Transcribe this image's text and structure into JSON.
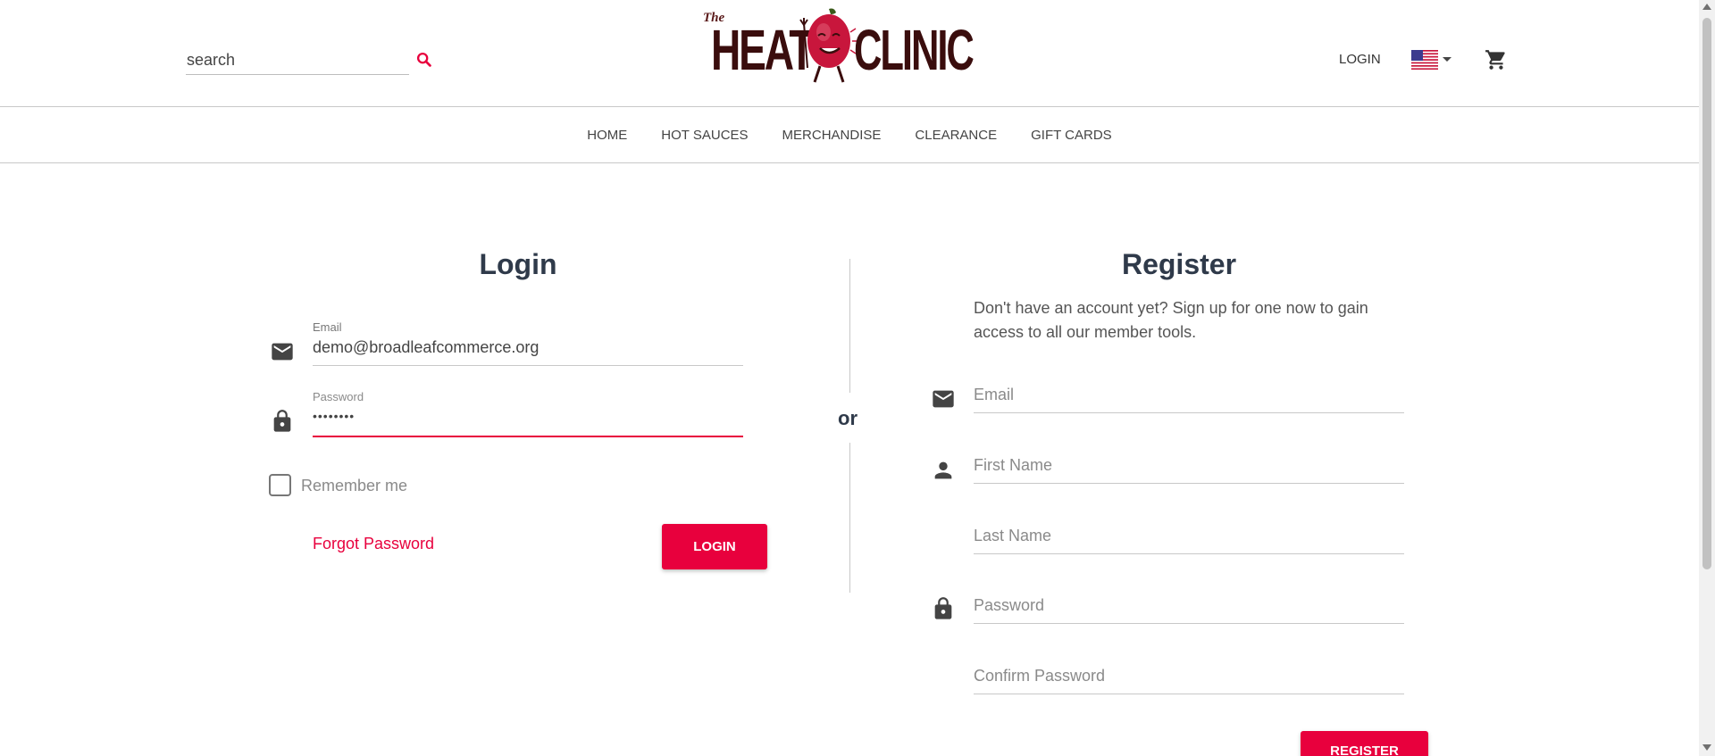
{
  "header": {
    "search_placeholder": "search",
    "search_icon": "search-icon",
    "logo": {
      "the": "The",
      "heat": "HEAT",
      "clinic": "CLINIC"
    },
    "login_label": "LOGIN",
    "flag_icon": "us-flag-icon",
    "cart_icon": "cart-icon"
  },
  "nav": {
    "items": [
      {
        "label": "HOME"
      },
      {
        "label": "HOT SAUCES"
      },
      {
        "label": "MERCHANDISE"
      },
      {
        "label": "CLEARANCE"
      },
      {
        "label": "GIFT CARDS"
      }
    ]
  },
  "login": {
    "title": "Login",
    "email_label": "Email",
    "email_value": "demo@broadleafcommerce.org",
    "password_label": "Password",
    "password_value": "••••••••",
    "remember_label": "Remember me",
    "forgot_label": "Forgot Password",
    "button_label": "LOGIN"
  },
  "divider": {
    "or_label": "or"
  },
  "register": {
    "title": "Register",
    "description": "Don't have an account yet? Sign up for one now to gain access to all our member tools.",
    "email_placeholder": "Email",
    "first_name_placeholder": "First Name",
    "last_name_placeholder": "Last Name",
    "password_placeholder": "Password",
    "confirm_password_placeholder": "Confirm Password",
    "button_label": "REGISTER"
  },
  "colors": {
    "accent": "#e8003d",
    "heading": "#2f3a4a",
    "logo": "#3a0d0d"
  }
}
